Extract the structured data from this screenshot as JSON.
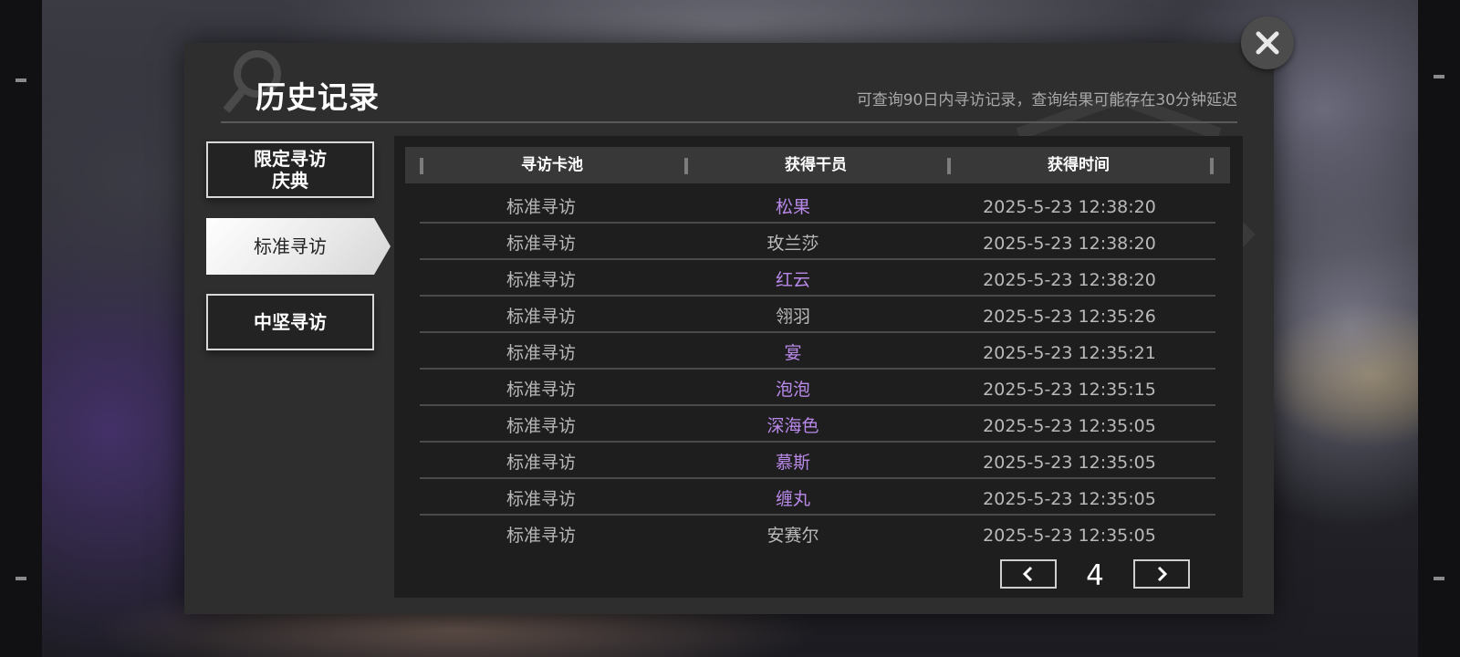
{
  "header": {
    "title": "历史记录",
    "subtitle": "可查询90日内寻访记录，查询结果可能存在30分钟延迟"
  },
  "tabs": [
    {
      "label": "限定寻访\n庆典",
      "line1": "限定寻访",
      "line2": "庆典",
      "active": false
    },
    {
      "label": "标准寻访",
      "active": true
    },
    {
      "label": "中坚寻访",
      "active": false
    }
  ],
  "table": {
    "columns": [
      "寻访卡池",
      "获得干员",
      "获得时间"
    ],
    "rows": [
      {
        "pool": "标准寻访",
        "operator": "松果",
        "time": "2025-5-23 12:38:20",
        "highlight": true
      },
      {
        "pool": "标准寻访",
        "operator": "玫兰莎",
        "time": "2025-5-23 12:38:20",
        "highlight": false
      },
      {
        "pool": "标准寻访",
        "operator": "红云",
        "time": "2025-5-23 12:38:20",
        "highlight": true
      },
      {
        "pool": "标准寻访",
        "operator": "翎羽",
        "time": "2025-5-23 12:35:26",
        "highlight": false
      },
      {
        "pool": "标准寻访",
        "operator": "宴",
        "time": "2025-5-23 12:35:21",
        "highlight": true
      },
      {
        "pool": "标准寻访",
        "operator": "泡泡",
        "time": "2025-5-23 12:35:15",
        "highlight": true
      },
      {
        "pool": "标准寻访",
        "operator": "深海色",
        "time": "2025-5-23 12:35:05",
        "highlight": true
      },
      {
        "pool": "标准寻访",
        "operator": "慕斯",
        "time": "2025-5-23 12:35:05",
        "highlight": true
      },
      {
        "pool": "标准寻访",
        "operator": "缠丸",
        "time": "2025-5-23 12:35:05",
        "highlight": true
      },
      {
        "pool": "标准寻访",
        "operator": "安赛尔",
        "time": "2025-5-23 12:35:05",
        "highlight": false
      }
    ]
  },
  "pager": {
    "page": "4",
    "prev_icon": "chevron-left-icon",
    "next_icon": "chevron-right-icon"
  },
  "close_icon": "close-icon",
  "colors": {
    "highlight_operator": "#b889e8",
    "normal_text": "#b9b9b9"
  }
}
